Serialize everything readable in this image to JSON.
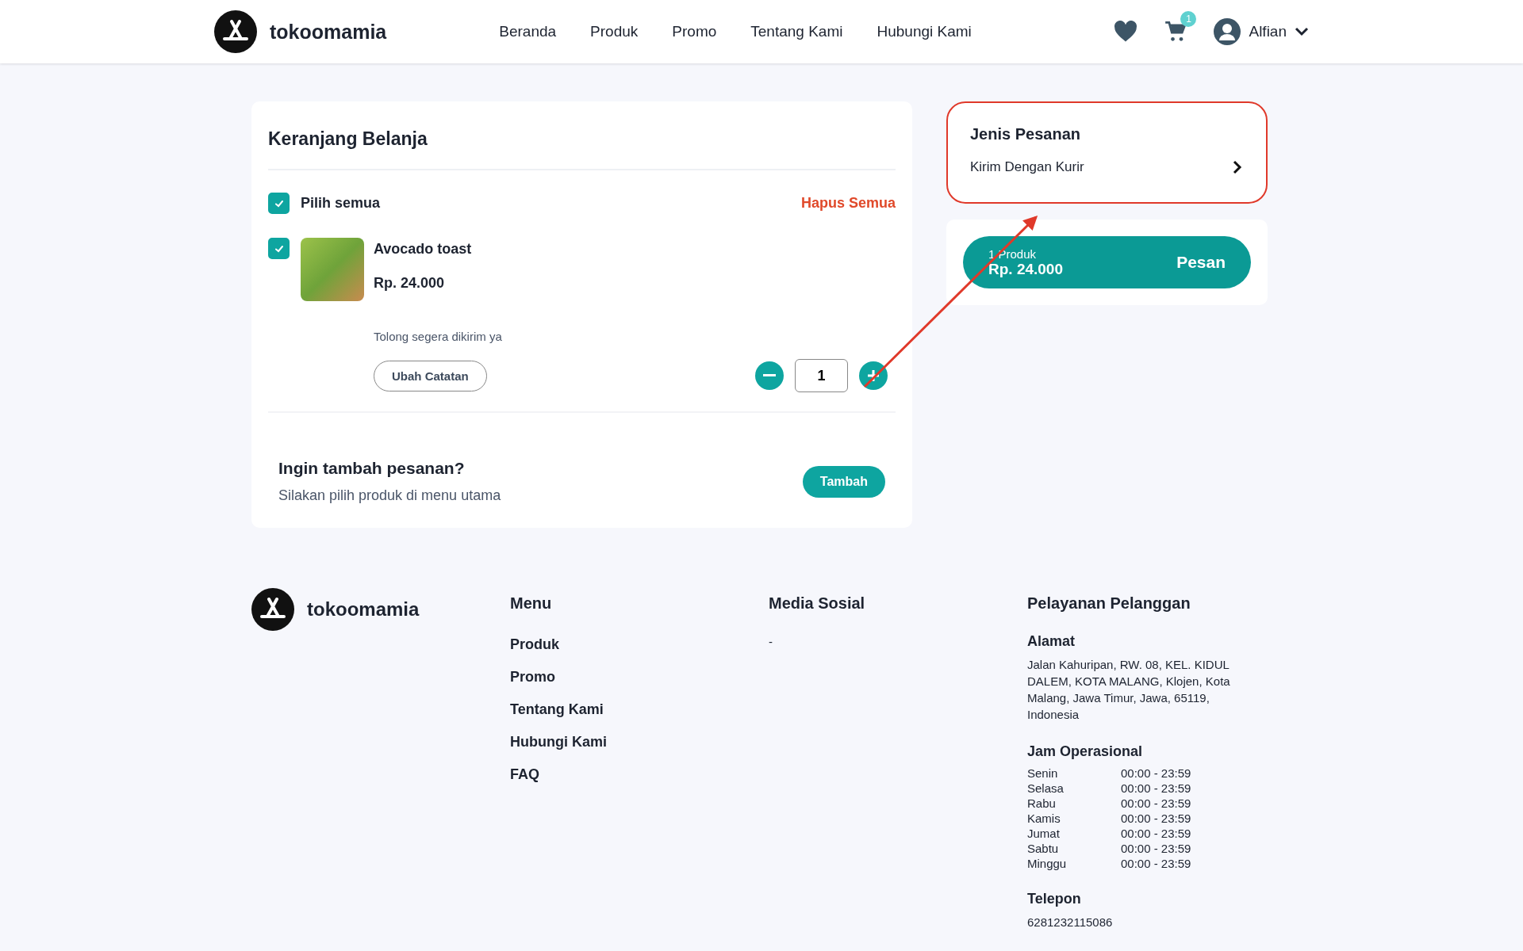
{
  "header": {
    "brand": "tokoomamia",
    "nav": [
      {
        "label": "Beranda"
      },
      {
        "label": "Produk"
      },
      {
        "label": "Promo"
      },
      {
        "label": "Tentang Kami"
      },
      {
        "label": "Hubungi Kami"
      }
    ],
    "cart_count": "1",
    "user_name": "Alfian"
  },
  "cart": {
    "title": "Keranjang Belanja",
    "select_all": {
      "label": "Pilih semua",
      "checked": true
    },
    "delete_all": "Hapus Semua",
    "items": [
      {
        "name": "Avocado toast",
        "price": "Rp. 24.000",
        "note": "Tolong segera dikirim ya",
        "note_button": "Ubah Catatan",
        "quantity": "1",
        "checked": true
      }
    ],
    "add_more": {
      "title": "Ingin tambah pesanan?",
      "subtitle": "Silakan pilih produk di menu utama",
      "button": "Tambah"
    }
  },
  "order_type": {
    "title": "Jenis Pesanan",
    "value": "Kirim Dengan Kurir"
  },
  "checkout": {
    "count": "1 Produk",
    "total": "Rp. 24.000",
    "button": "Pesan"
  },
  "footer": {
    "brand": "tokoomamia",
    "menu": {
      "title": "Menu",
      "links": [
        "Produk",
        "Promo",
        "Tentang Kami",
        "Hubungi Kami",
        "FAQ"
      ]
    },
    "social": {
      "title": "Media Sosial",
      "text": "-"
    },
    "service": {
      "title": "Pelayanan Pelanggan",
      "address_title": "Alamat",
      "address": "Jalan Kahuripan, RW. 08, KEL. KIDUL DALEM, KOTA MALANG, Klojen, Kota Malang, Jawa Timur, Jawa, 65119, Indonesia",
      "hours_title": "Jam Operasional",
      "hours": [
        {
          "day": "Senin",
          "time": "00:00 - 23:59"
        },
        {
          "day": "Selasa",
          "time": "00:00 - 23:59"
        },
        {
          "day": "Rabu",
          "time": "00:00 - 23:59"
        },
        {
          "day": "Kamis",
          "time": "00:00 - 23:59"
        },
        {
          "day": "Jumat",
          "time": "00:00 - 23:59"
        },
        {
          "day": "Sabtu",
          "time": "00:00 - 23:59"
        },
        {
          "day": "Minggu",
          "time": "00:00 - 23:59"
        }
      ],
      "phone_title": "Telepon",
      "phone": "6281232115086"
    }
  }
}
